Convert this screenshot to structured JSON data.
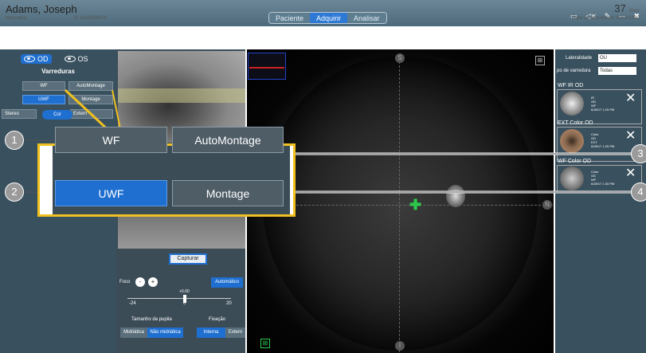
{
  "nav": {
    "tabs": [
      "Paciente",
      "Adquirir",
      "Analisar"
    ],
    "active": "Adquirir"
  },
  "topicons": [
    "monitor-icon",
    "speaker-icon",
    "wrench-icon",
    "minimize-icon",
    "close-icon"
  ],
  "patient": {
    "name": "Adams, Joseph",
    "gender": "Masculino",
    "id": "ID 1815936029",
    "age": "37",
    "age_unit": "Anos",
    "dob": "Data de nascimento  02/02/1982"
  },
  "left": {
    "eye_od": "OD",
    "eye_os": "OS",
    "section": "Varreduras",
    "buttons": {
      "wf": "WF",
      "automontage": "AutoMontage",
      "uwf": "UWF",
      "montage": "Montage",
      "stereo": "Stereo",
      "external": "Extern"
    },
    "cor": "Cor"
  },
  "middle": {
    "capture": "Capturar",
    "focus_label": "Foco",
    "minus": "-",
    "plus": "+",
    "auto": "Automático",
    "focus_value": "+0.00",
    "min": "-24",
    "zero": "0",
    "max": "20",
    "pupil_title": "Tamanho da pupila",
    "fix_title": "Fixação",
    "pupil_opts": [
      "Midriática",
      "Não midriática"
    ],
    "fix_opts": [
      "Interna",
      "Extern"
    ]
  },
  "right": {
    "lat_label": "Lateralidade",
    "lat_value": "OU",
    "scan_label": "po de varredura",
    "scan_value": "Todas",
    "cards": [
      {
        "header": "WF    IR    OD",
        "info": [
          "IR",
          "OD",
          "WF",
          "6/28/17   1:29 PM"
        ]
      },
      {
        "header": "EXT   Color    OD",
        "info": [
          "Color",
          "OD",
          "EXT",
          "6/28/17   1:29 PM"
        ]
      },
      {
        "header": "WF    Color    OD",
        "info": [
          "Color",
          "OD",
          "WF",
          "6/28/17   1:30 PM"
        ]
      }
    ]
  },
  "callout": {
    "wf": "WF",
    "automontage": "AutoMontage",
    "uwf": "UWF",
    "montage": "Montage",
    "numbers": [
      "1",
      "2",
      "3",
      "4"
    ]
  },
  "colors": {
    "accent": "#1f6fd0",
    "highlight": "#f0c020"
  }
}
